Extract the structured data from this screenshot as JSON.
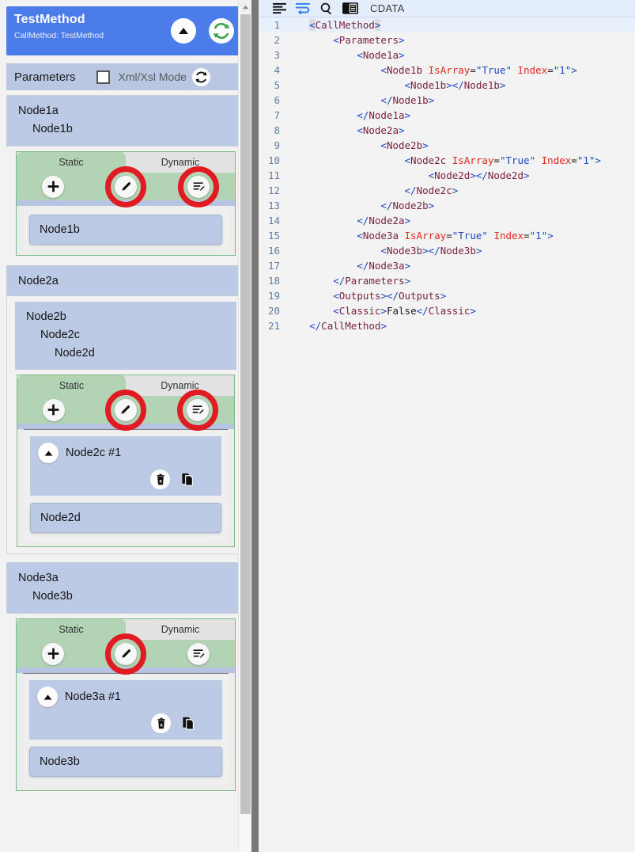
{
  "header": {
    "title": "TestMethod",
    "subtitle": "CallMethod: TestMethod",
    "collapse_icon": "chevron-up-icon",
    "refresh_icon": "sync-refresh-icon",
    "bg_color": "#4c7cea"
  },
  "params_bar": {
    "label": "Parameters",
    "checkbox_checked": false,
    "mode_label": "Xml/Xsl Mode",
    "refresh_icon": "refresh-icon",
    "bg_color": "#b9c7e2"
  },
  "tabs": {
    "static": "Static",
    "dynamic": "Dynamic",
    "active": "Static"
  },
  "toolbar_icons": {
    "add": "plus-icon",
    "edit": "pencil-icon",
    "edit_list": "edit-list-icon"
  },
  "item_icons": {
    "collapse": "chevron-up-icon",
    "delete": "trash-delete-icon",
    "duplicate": "copy-duplicate-icon"
  },
  "annotation": {
    "color": "#e01b22",
    "shape": "circle-highlight"
  },
  "groups": [
    {
      "id": "group-node1a",
      "head_lines": [
        "Node1a",
        "Node1b"
      ],
      "annotated": [
        "pencil",
        "edit-list"
      ],
      "item": null,
      "leaf": "Node1b"
    },
    {
      "id": "group-node2a",
      "head_lines": [
        "Node2a"
      ],
      "sub_head_lines": [
        "Node2b",
        "Node2c",
        "Node2d"
      ],
      "annotated": [
        "pencil",
        "edit-list"
      ],
      "item": "Node2c #1",
      "leaf": "Node2d"
    },
    {
      "id": "group-node3a",
      "head_lines": [
        "Node3a",
        "Node3b"
      ],
      "annotated": [
        "pencil"
      ],
      "item": "Node3a #1",
      "leaf": "Node3b"
    }
  ],
  "editor": {
    "toolbar": {
      "format_icon": "format-lines-icon",
      "wordwrap_icon": "word-wrap-icon",
      "search_icon": "search-icon",
      "cdata_icon": "cdata-toggle-icon",
      "cdata_label": "CDATA"
    },
    "line_count": 21,
    "active_line": 1,
    "lines": [
      {
        "n": 1,
        "indent": 0,
        "html": "<span class=\"tag hl\">&lt;</span><span class=\"name\">CallMethod</span><span class=\"tag hl\">&gt;</span>"
      },
      {
        "n": 2,
        "indent": 1,
        "html": "<span class=\"tag\">&lt;</span><span class=\"name\">Parameters</span><span class=\"tag\">&gt;</span>"
      },
      {
        "n": 3,
        "indent": 2,
        "html": "<span class=\"tag\">&lt;</span><span class=\"name\">Node1a</span><span class=\"tag\">&gt;</span>"
      },
      {
        "n": 4,
        "indent": 3,
        "html": "<span class=\"tag\">&lt;</span><span class=\"name\">Node1b</span> <span class=\"attr\">IsArray</span><span class=\"eq\">=</span><span class=\"val\">\"True\"</span> <span class=\"attr\">Index</span><span class=\"eq\">=</span><span class=\"val\">\"1\"</span><span class=\"tag\">&gt;</span>"
      },
      {
        "n": 5,
        "indent": 4,
        "html": "<span class=\"tag\">&lt;</span><span class=\"name\">Node1b</span><span class=\"tag\">&gt;&lt;/</span><span class=\"name\">Node1b</span><span class=\"tag\">&gt;</span>"
      },
      {
        "n": 6,
        "indent": 3,
        "html": "<span class=\"tag\">&lt;/</span><span class=\"name\">Node1b</span><span class=\"tag\">&gt;</span>"
      },
      {
        "n": 7,
        "indent": 2,
        "html": "<span class=\"tag\">&lt;/</span><span class=\"name\">Node1a</span><span class=\"tag\">&gt;</span>"
      },
      {
        "n": 8,
        "indent": 2,
        "html": "<span class=\"tag\">&lt;</span><span class=\"name\">Node2a</span><span class=\"tag\">&gt;</span>"
      },
      {
        "n": 9,
        "indent": 3,
        "html": "<span class=\"tag\">&lt;</span><span class=\"name\">Node2b</span><span class=\"tag\">&gt;</span>"
      },
      {
        "n": 10,
        "indent": 4,
        "html": "<span class=\"tag\">&lt;</span><span class=\"name\">Node2c</span> <span class=\"attr\">IsArray</span><span class=\"eq\">=</span><span class=\"val\">\"True\"</span> <span class=\"attr\">Index</span><span class=\"eq\">=</span><span class=\"val\">\"1\"</span><span class=\"tag\">&gt;</span>"
      },
      {
        "n": 11,
        "indent": 5,
        "html": "<span class=\"tag\">&lt;</span><span class=\"name\">Node2d</span><span class=\"tag\">&gt;&lt;/</span><span class=\"name\">Node2d</span><span class=\"tag\">&gt;</span>"
      },
      {
        "n": 12,
        "indent": 4,
        "html": "<span class=\"tag\">&lt;/</span><span class=\"name\">Node2c</span><span class=\"tag\">&gt;</span>"
      },
      {
        "n": 13,
        "indent": 3,
        "html": "<span class=\"tag\">&lt;/</span><span class=\"name\">Node2b</span><span class=\"tag\">&gt;</span>"
      },
      {
        "n": 14,
        "indent": 2,
        "html": "<span class=\"tag\">&lt;/</span><span class=\"name\">Node2a</span><span class=\"tag\">&gt;</span>"
      },
      {
        "n": 15,
        "indent": 2,
        "html": "<span class=\"tag\">&lt;</span><span class=\"name\">Node3a</span> <span class=\"attr\">IsArray</span><span class=\"eq\">=</span><span class=\"val\">\"True\"</span> <span class=\"attr\">Index</span><span class=\"eq\">=</span><span class=\"val\">\"1\"</span><span class=\"tag\">&gt;</span>"
      },
      {
        "n": 16,
        "indent": 3,
        "html": "<span class=\"tag\">&lt;</span><span class=\"name\">Node3b</span><span class=\"tag\">&gt;&lt;/</span><span class=\"name\">Node3b</span><span class=\"tag\">&gt;</span>"
      },
      {
        "n": 17,
        "indent": 2,
        "html": "<span class=\"tag\">&lt;/</span><span class=\"name\">Node3a</span><span class=\"tag\">&gt;</span>"
      },
      {
        "n": 18,
        "indent": 1,
        "html": "<span class=\"tag\">&lt;/</span><span class=\"name\">Parameters</span><span class=\"tag\">&gt;</span>"
      },
      {
        "n": 19,
        "indent": 1,
        "html": "<span class=\"tag\">&lt;</span><span class=\"name\">Outputs</span><span class=\"tag\">&gt;&lt;/</span><span class=\"name\">Outputs</span><span class=\"tag\">&gt;</span>"
      },
      {
        "n": 20,
        "indent": 1,
        "html": "<span class=\"tag\">&lt;</span><span class=\"name\">Classic</span><span class=\"tag\">&gt;</span><span class=\"plain\">False</span><span class=\"tag\">&lt;/</span><span class=\"name\">Classic</span><span class=\"tag\">&gt;</span>"
      },
      {
        "n": 21,
        "indent": 0,
        "html": "<span class=\"tag\">&lt;/</span><span class=\"name\">CallMethod</span><span class=\"tag\">&gt;</span>"
      }
    ],
    "xml_text": "<CallMethod>\n    <Parameters>\n        <Node1a>\n            <Node1b IsArray=\"True\" Index=\"1\">\n                <Node1b></Node1b>\n            </Node1b>\n        </Node1a>\n        <Node2a>\n            <Node2b>\n                <Node2c IsArray=\"True\" Index=\"1\">\n                    <Node2d></Node2d>\n                </Node2c>\n            </Node2b>\n        </Node2a>\n        <Node3a IsArray=\"True\" Index=\"1\">\n            <Node3b></Node3b>\n        </Node3a>\n    </Parameters>\n    <Outputs></Outputs>\n    <Classic>False</Classic>\n</CallMethod>"
  }
}
